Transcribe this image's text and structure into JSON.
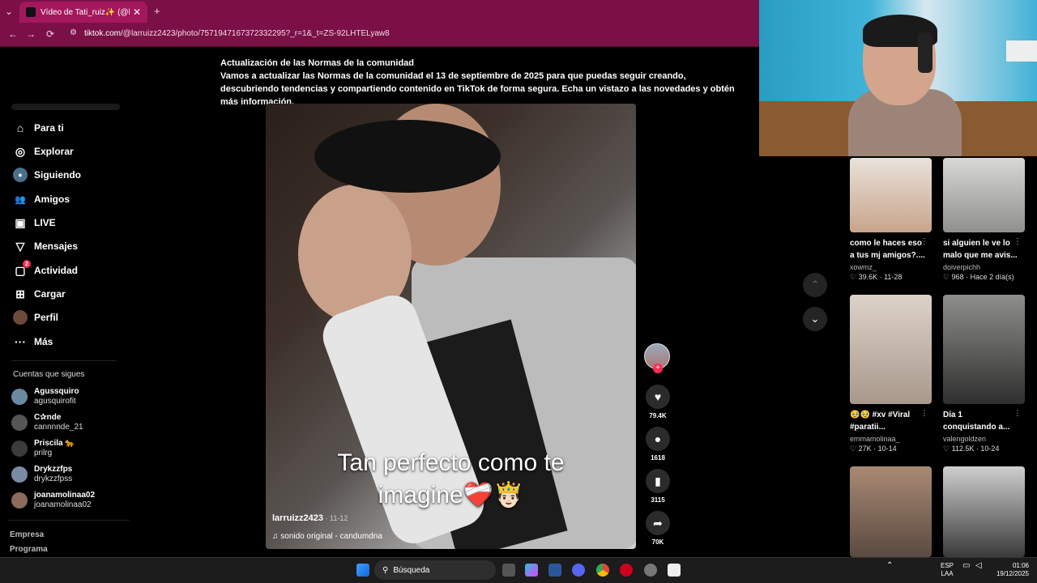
{
  "browser": {
    "tab_title": "Vídeo de Tati_ruiz✨ (@larruiz...",
    "tab_close": "✕",
    "new_tab": "+",
    "url_domain": "tiktok.com",
    "url_path": "/@larruizz2423/photo/7571947167372332295?_r=1&_t=ZS-92LHTELyaw8",
    "back": "←",
    "forward": "→",
    "reload": "⟳"
  },
  "banner": {
    "title": "Actualización de las Normas de la comunidad",
    "body": "Vamos a actualizar las Normas de la comunidad el 13 de septiembre de 2025 para que puedas seguir creando, descubriendo tendencias y compartiendo contenido en TikTok de forma segura. Echa un vistazo a las novedades y obtén más información."
  },
  "sidebar": {
    "items": [
      {
        "label": "Para ti",
        "icon": "⌂"
      },
      {
        "label": "Explorar",
        "icon": "◎"
      },
      {
        "label": "Siguiendo",
        "icon": "●"
      },
      {
        "label": "Amigos",
        "icon": "👥"
      },
      {
        "label": "LIVE",
        "icon": "▣"
      },
      {
        "label": "Mensajes",
        "icon": "▽"
      },
      {
        "label": "Actividad",
        "icon": "▢",
        "badge": "2"
      },
      {
        "label": "Cargar",
        "icon": "⊞"
      },
      {
        "label": "Perfil",
        "icon": "●"
      },
      {
        "label": "Más",
        "icon": "···"
      }
    ],
    "following_title": "Cuentas que sigues",
    "following": [
      {
        "name": "Agussquiro",
        "handle": "agusquirofit"
      },
      {
        "name": "C✰nde",
        "handle": "cannnnde_21"
      },
      {
        "name": "Priscila 🐆",
        "handle": "prilrg"
      },
      {
        "name": "Drykzzfps",
        "handle": "drykzzfpss"
      },
      {
        "name": "joanamolinaa02",
        "handle": "joanamolinaa02"
      }
    ],
    "footer": [
      "Empresa",
      "Programa"
    ]
  },
  "video": {
    "caption_line1": "Tan perfecto como te",
    "caption_line2": "imagine❤️‍🩹🤴🏻",
    "author": "larruizz2423",
    "date": " · 11-12",
    "music": "♫  sonido original - candumdna"
  },
  "actions": {
    "like": {
      "icon": "♥",
      "count": "79.4K"
    },
    "comment": {
      "icon": "●",
      "count": "1618"
    },
    "save": {
      "icon": "▮",
      "count": "3115"
    },
    "share": {
      "icon": "➦",
      "count": "70K"
    },
    "follow_plus": "+"
  },
  "nav": {
    "up": "⌃",
    "down": "⌄"
  },
  "recommended": [
    {
      "caption1": "como le haces eso",
      "caption2": "a tus mj amigos?....",
      "user": "xowmz_",
      "meta": "♡ 39.6K · 11-28",
      "color": "#c8b7a6"
    },
    {
      "caption1": "si alguien le ve lo",
      "caption2": "malo que me avis...",
      "user": "doiverpichh",
      "meta": "♡ 968 · Hace 2 día(s)",
      "color": "#a9a9a6"
    },
    {
      "caption1": "🥹🥹 #xv #Viral",
      "caption2": "#paratii...",
      "user": "emmamolinaa_",
      "meta": "♡ 27K · 10-14",
      "color": "#c4b1a8"
    },
    {
      "caption1": "Día 1",
      "caption2": "conquistando a...",
      "user": "valengoldzen",
      "meta": "♡ 112.5K · 10-24",
      "color": "#6f6b69"
    },
    {
      "caption1": "",
      "caption2": "",
      "user": "",
      "meta": "",
      "color": "#8f7a6b"
    },
    {
      "caption1": "",
      "caption2": "",
      "user": "",
      "meta": "",
      "color": "#9a9a9a"
    }
  ],
  "taskbar": {
    "search_label": "Búsqueda",
    "lang1": "ESP",
    "lang2": "LAA",
    "time": "01:06",
    "date": "19/12/2025"
  }
}
